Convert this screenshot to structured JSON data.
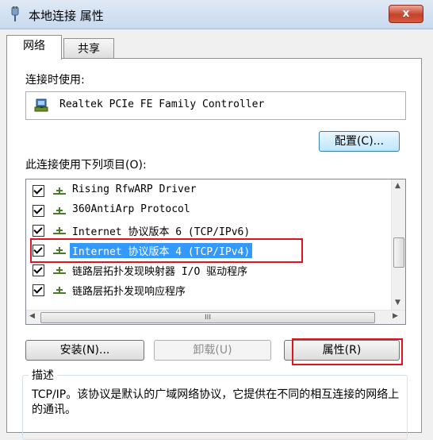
{
  "window": {
    "title": "本地连接 属性",
    "close_label": "x",
    "title_icon": "network-plug-icon",
    "accent": "#c7402a"
  },
  "tabs": [
    {
      "label": "网络",
      "active": true
    },
    {
      "label": "共享",
      "active": false
    }
  ],
  "connect_using": {
    "label": "连接时使用:",
    "adapter": "Realtek PCIe FE Family Controller",
    "adapter_icon": "network-adapter-icon",
    "configure_label": "配置(C)..."
  },
  "items": {
    "label": "此连接使用下列项目(O):",
    "list": [
      {
        "text": "Rising RfwARP Driver",
        "checked": true,
        "selected": false
      },
      {
        "text": "360AntiArp Protocol",
        "checked": true,
        "selected": false
      },
      {
        "text": "Internet 协议版本 6 (TCP/IPv6)",
        "checked": true,
        "selected": false
      },
      {
        "text": "Internet 协议版本 4 (TCP/IPv4)",
        "checked": true,
        "selected": true
      },
      {
        "text": "链路层拓扑发现映射器 I/O 驱动程序",
        "checked": true,
        "selected": false
      },
      {
        "text": "链路层拓扑发现响应程序",
        "checked": true,
        "selected": false
      }
    ],
    "item_icon": "protocol-icon",
    "selection_color": "#3399ff",
    "highlight_color": "#e0141e",
    "scrollbar_thumb_glyph": "III"
  },
  "buttons": {
    "install": "安装(N)...",
    "uninstall": "卸载(U)",
    "properties": "属性(R)"
  },
  "description": {
    "legend": "描述",
    "text": "TCP/IP。该协议是默认的广域网络协议，它提供在不同的相互连接的网络上的通讯。"
  }
}
